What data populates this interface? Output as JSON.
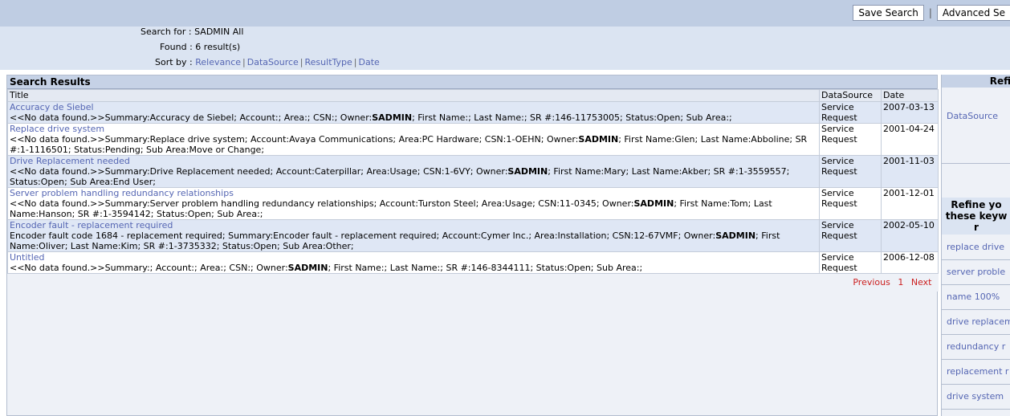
{
  "toolbar": {
    "save_search": "Save Search",
    "separator": "|",
    "advanced_search": "Advanced Se"
  },
  "header": {
    "search_for_label": "Search for :",
    "search_for_value": "SADMIN All",
    "found_label": "Found :",
    "found_value": "6 result(s)",
    "sort_label": "Sort by :",
    "sort_options": [
      "Relevance",
      "DataSource",
      "ResultType",
      "Date"
    ]
  },
  "results": {
    "section_title": "Search Results",
    "columns": [
      "Title",
      "DataSource",
      "Date"
    ],
    "rows": [
      {
        "title": "Accuracy de Siebel",
        "desc_pre": "<<No data found.>>Summary:Accuracy de Siebel; Account:; Area:; CSN:; Owner:",
        "owner": "SADMIN",
        "desc_post": "; First Name:; Last Name:; SR #:146-11753005; Status:Open; Sub Area:;",
        "datasource": "Service Request",
        "date": "2007-03-13"
      },
      {
        "title": "Replace drive system",
        "desc_pre": "<<No data found.>>Summary:Replace drive system; Account:Avaya Communications; Area:PC Hardware; CSN:1-OEHN; Owner:",
        "owner": "SADMIN",
        "desc_post": "; First Name:Glen; Last Name:Abboline; SR #:1-1116501; Status:Pending; Sub Area:Move or Change;",
        "datasource": "Service Request",
        "date": "2001-04-24"
      },
      {
        "title": "Drive Replacement needed",
        "desc_pre": "<<No data found.>>Summary:Drive Replacement needed; Account:Caterpillar; Area:Usage; CSN:1-6VY; Owner:",
        "owner": "SADMIN",
        "desc_post": "; First Name:Mary; Last Name:Akber; SR #:1-3559557; Status:Open; Sub Area:End User;",
        "datasource": "Service Request",
        "date": "2001-11-03"
      },
      {
        "title": "Server problem handling redundancy relationships",
        "desc_pre": "<<No data found.>>Summary:Server problem handling redundancy relationships; Account:Turston Steel; Area:Usage; CSN:11-0345; Owner:",
        "owner": "SADMIN",
        "desc_post": "; First Name:Tom; Last Name:Hanson; SR #:1-3594142; Status:Open; Sub Area:;",
        "datasource": "Service Request",
        "date": "2001-12-01"
      },
      {
        "title": "Encoder fault - replacement required",
        "desc_pre": "Encoder fault code 1684 - replacement required; Summary:Encoder fault - replacement required; Account:Cymer Inc.; Area:Installation; CSN:12-67VMF; Owner:",
        "owner": "SADMIN",
        "desc_post": "; First Name:Oliver; Last Name:Kim; SR #:1-3735332; Status:Open; Sub Area:Other;",
        "datasource": "Service Request",
        "date": "2002-05-10"
      },
      {
        "title": "Untitled",
        "desc_pre": "<<No data found.>>Summary:; Account:; Area:; CSN:; Owner:",
        "owner": "SADMIN",
        "desc_post": "; First Name:; Last Name:; SR #:146-8344111; Status:Open; Sub Area:;",
        "datasource": "Service Request",
        "date": "2006-12-08"
      }
    ],
    "pager": {
      "previous": "Previous",
      "page": "1",
      "next": "Next"
    }
  },
  "refine": {
    "header": "Refi",
    "datasource_link": "DataSource",
    "keywords_header_lines": [
      "Refine yo",
      "these keyw",
      "r"
    ],
    "keywords": [
      "replace drive",
      "server proble",
      "name 100%",
      "drive replacem",
      "redundancy r",
      "replacement r",
      "drive system"
    ]
  }
}
